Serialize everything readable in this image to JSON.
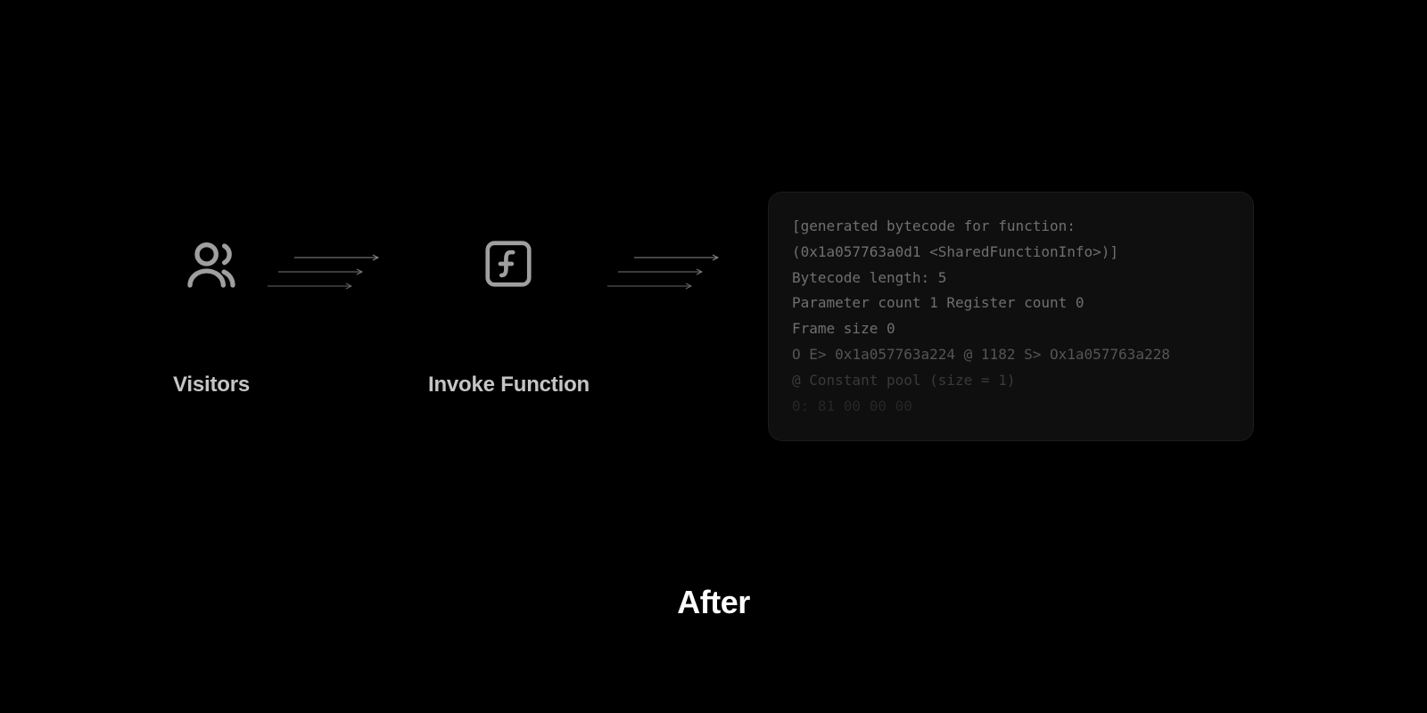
{
  "steps": {
    "visitors": {
      "label": "Visitors"
    },
    "invoke": {
      "label": "Invoke Function"
    }
  },
  "code_lines": [
    "[generated bytecode for function:",
    "(0x1a057763a0d1 <SharedFunctionInfo>)]",
    "Bytecode length: 5",
    "Parameter count 1 Register count 0",
    "Frame size 0",
    "O E> 0x1a057763a224 @ 1182 S> Ox1a057763a228",
    "@ Constant pool (size = 1)",
    "0: 81 00 00 00"
  ],
  "caption": "After"
}
